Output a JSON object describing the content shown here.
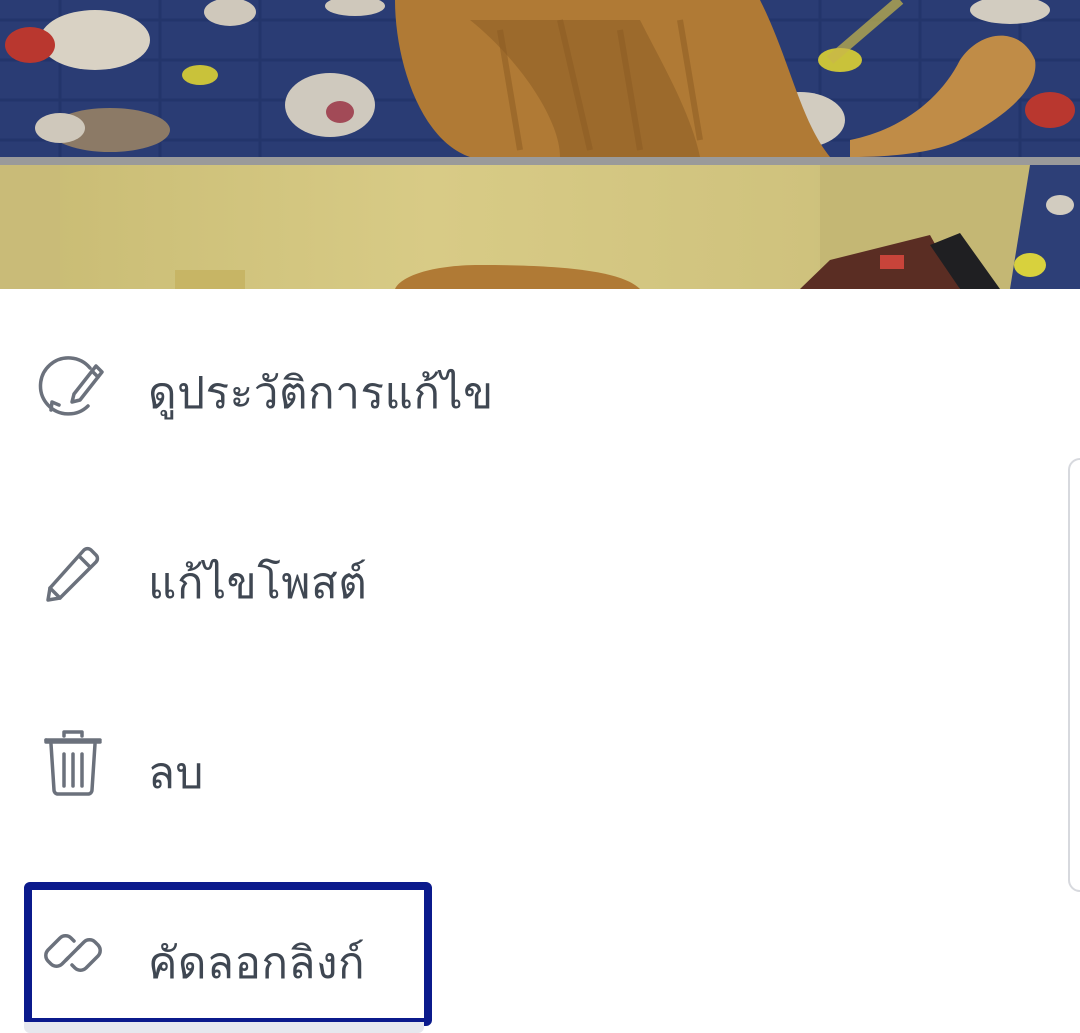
{
  "menu": {
    "items": [
      {
        "id": "view-edit-history",
        "label": "ดูประวัติการแก้ไข",
        "icon": "edit-history-icon"
      },
      {
        "id": "edit-post",
        "label": "แก้ไขโพสต์",
        "icon": "pencil-icon"
      },
      {
        "id": "delete",
        "label": "ลบ",
        "icon": "trash-icon"
      },
      {
        "id": "copy-link",
        "label": "คัดลอกลิงก์",
        "icon": "link-icon"
      }
    ]
  },
  "colors": {
    "label_text": "#3f4752",
    "icon_stroke": "#6b717c",
    "highlight_border": "#0b1a8c"
  }
}
